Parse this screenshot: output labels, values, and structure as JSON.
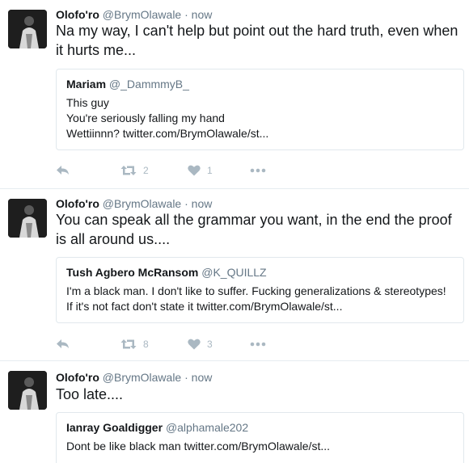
{
  "tweets": [
    {
      "name": "Olofo'ro",
      "handle": "@BrymOlawale",
      "dot": "·",
      "time": "now",
      "text": "Na my way, I can't help but point out the hard truth, even when it hurts me...",
      "quote": {
        "name": "Mariam",
        "handle": "@_DammmyB_",
        "lines": [
          "This guy",
          "You're seriously falling my hand",
          "Wettiinnn? twitter.com/BrymOlawale/st..."
        ]
      },
      "retweets": "2",
      "likes": "1"
    },
    {
      "name": "Olofo'ro",
      "handle": "@BrymOlawale",
      "dot": "·",
      "time": "now",
      "text": "You can speak all the grammar you want, in the end the proof is all around us....",
      "quote": {
        "name": "Tush Agbero McRansom",
        "handle": "@K_QUILLZ",
        "lines": [
          "I'm a black man. I don't like to suffer. Fucking generalizations & stereotypes!",
          "If it's not fact don't state it twitter.com/BrymOlawale/st..."
        ]
      },
      "retweets": "8",
      "likes": "3"
    },
    {
      "name": "Olofo'ro",
      "handle": "@BrymOlawale",
      "dot": "·",
      "time": "now",
      "text": "Too late....",
      "quote": {
        "name": "Ianray Goaldigger",
        "handle": "@alphamale202",
        "lines": [
          "Dont be like black man  twitter.com/BrymOlawale/st..."
        ]
      }
    }
  ],
  "icons": {
    "reply": "reply-icon",
    "retweet": "retweet-icon",
    "like": "heart-icon",
    "more": "more-icon"
  },
  "colors": {
    "icon": "#aab8c2",
    "border": "#e1e8ed",
    "secondary_text": "#657786"
  }
}
